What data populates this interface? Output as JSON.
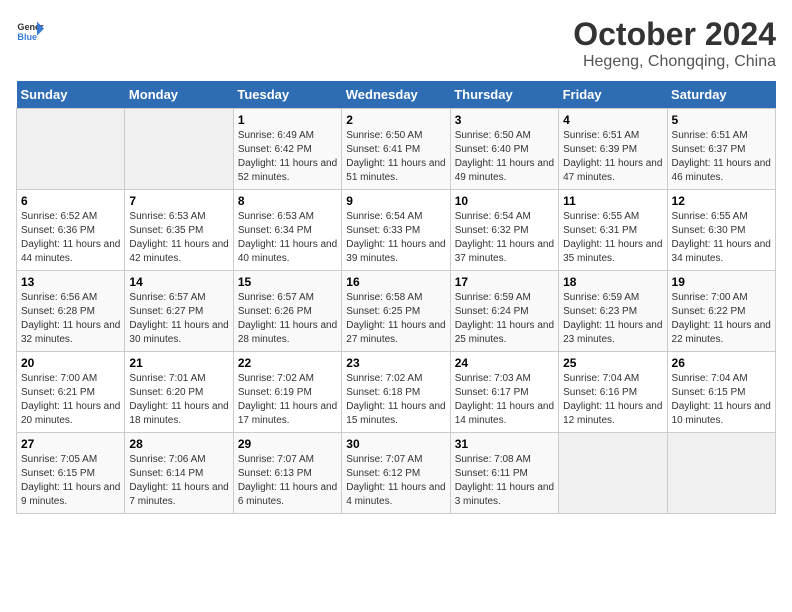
{
  "header": {
    "logo_general": "General",
    "logo_blue": "Blue",
    "title": "October 2024",
    "subtitle": "Hegeng, Chongqing, China"
  },
  "weekdays": [
    "Sunday",
    "Monday",
    "Tuesday",
    "Wednesday",
    "Thursday",
    "Friday",
    "Saturday"
  ],
  "weeks": [
    [
      {
        "day": "",
        "detail": ""
      },
      {
        "day": "",
        "detail": ""
      },
      {
        "day": "1",
        "detail": "Sunrise: 6:49 AM\nSunset: 6:42 PM\nDaylight: 11 hours and 52 minutes."
      },
      {
        "day": "2",
        "detail": "Sunrise: 6:50 AM\nSunset: 6:41 PM\nDaylight: 11 hours and 51 minutes."
      },
      {
        "day": "3",
        "detail": "Sunrise: 6:50 AM\nSunset: 6:40 PM\nDaylight: 11 hours and 49 minutes."
      },
      {
        "day": "4",
        "detail": "Sunrise: 6:51 AM\nSunset: 6:39 PM\nDaylight: 11 hours and 47 minutes."
      },
      {
        "day": "5",
        "detail": "Sunrise: 6:51 AM\nSunset: 6:37 PM\nDaylight: 11 hours and 46 minutes."
      }
    ],
    [
      {
        "day": "6",
        "detail": "Sunrise: 6:52 AM\nSunset: 6:36 PM\nDaylight: 11 hours and 44 minutes."
      },
      {
        "day": "7",
        "detail": "Sunrise: 6:53 AM\nSunset: 6:35 PM\nDaylight: 11 hours and 42 minutes."
      },
      {
        "day": "8",
        "detail": "Sunrise: 6:53 AM\nSunset: 6:34 PM\nDaylight: 11 hours and 40 minutes."
      },
      {
        "day": "9",
        "detail": "Sunrise: 6:54 AM\nSunset: 6:33 PM\nDaylight: 11 hours and 39 minutes."
      },
      {
        "day": "10",
        "detail": "Sunrise: 6:54 AM\nSunset: 6:32 PM\nDaylight: 11 hours and 37 minutes."
      },
      {
        "day": "11",
        "detail": "Sunrise: 6:55 AM\nSunset: 6:31 PM\nDaylight: 11 hours and 35 minutes."
      },
      {
        "day": "12",
        "detail": "Sunrise: 6:55 AM\nSunset: 6:30 PM\nDaylight: 11 hours and 34 minutes."
      }
    ],
    [
      {
        "day": "13",
        "detail": "Sunrise: 6:56 AM\nSunset: 6:28 PM\nDaylight: 11 hours and 32 minutes."
      },
      {
        "day": "14",
        "detail": "Sunrise: 6:57 AM\nSunset: 6:27 PM\nDaylight: 11 hours and 30 minutes."
      },
      {
        "day": "15",
        "detail": "Sunrise: 6:57 AM\nSunset: 6:26 PM\nDaylight: 11 hours and 28 minutes."
      },
      {
        "day": "16",
        "detail": "Sunrise: 6:58 AM\nSunset: 6:25 PM\nDaylight: 11 hours and 27 minutes."
      },
      {
        "day": "17",
        "detail": "Sunrise: 6:59 AM\nSunset: 6:24 PM\nDaylight: 11 hours and 25 minutes."
      },
      {
        "day": "18",
        "detail": "Sunrise: 6:59 AM\nSunset: 6:23 PM\nDaylight: 11 hours and 23 minutes."
      },
      {
        "day": "19",
        "detail": "Sunrise: 7:00 AM\nSunset: 6:22 PM\nDaylight: 11 hours and 22 minutes."
      }
    ],
    [
      {
        "day": "20",
        "detail": "Sunrise: 7:00 AM\nSunset: 6:21 PM\nDaylight: 11 hours and 20 minutes."
      },
      {
        "day": "21",
        "detail": "Sunrise: 7:01 AM\nSunset: 6:20 PM\nDaylight: 11 hours and 18 minutes."
      },
      {
        "day": "22",
        "detail": "Sunrise: 7:02 AM\nSunset: 6:19 PM\nDaylight: 11 hours and 17 minutes."
      },
      {
        "day": "23",
        "detail": "Sunrise: 7:02 AM\nSunset: 6:18 PM\nDaylight: 11 hours and 15 minutes."
      },
      {
        "day": "24",
        "detail": "Sunrise: 7:03 AM\nSunset: 6:17 PM\nDaylight: 11 hours and 14 minutes."
      },
      {
        "day": "25",
        "detail": "Sunrise: 7:04 AM\nSunset: 6:16 PM\nDaylight: 11 hours and 12 minutes."
      },
      {
        "day": "26",
        "detail": "Sunrise: 7:04 AM\nSunset: 6:15 PM\nDaylight: 11 hours and 10 minutes."
      }
    ],
    [
      {
        "day": "27",
        "detail": "Sunrise: 7:05 AM\nSunset: 6:15 PM\nDaylight: 11 hours and 9 minutes."
      },
      {
        "day": "28",
        "detail": "Sunrise: 7:06 AM\nSunset: 6:14 PM\nDaylight: 11 hours and 7 minutes."
      },
      {
        "day": "29",
        "detail": "Sunrise: 7:07 AM\nSunset: 6:13 PM\nDaylight: 11 hours and 6 minutes."
      },
      {
        "day": "30",
        "detail": "Sunrise: 7:07 AM\nSunset: 6:12 PM\nDaylight: 11 hours and 4 minutes."
      },
      {
        "day": "31",
        "detail": "Sunrise: 7:08 AM\nSunset: 6:11 PM\nDaylight: 11 hours and 3 minutes."
      },
      {
        "day": "",
        "detail": ""
      },
      {
        "day": "",
        "detail": ""
      }
    ]
  ]
}
